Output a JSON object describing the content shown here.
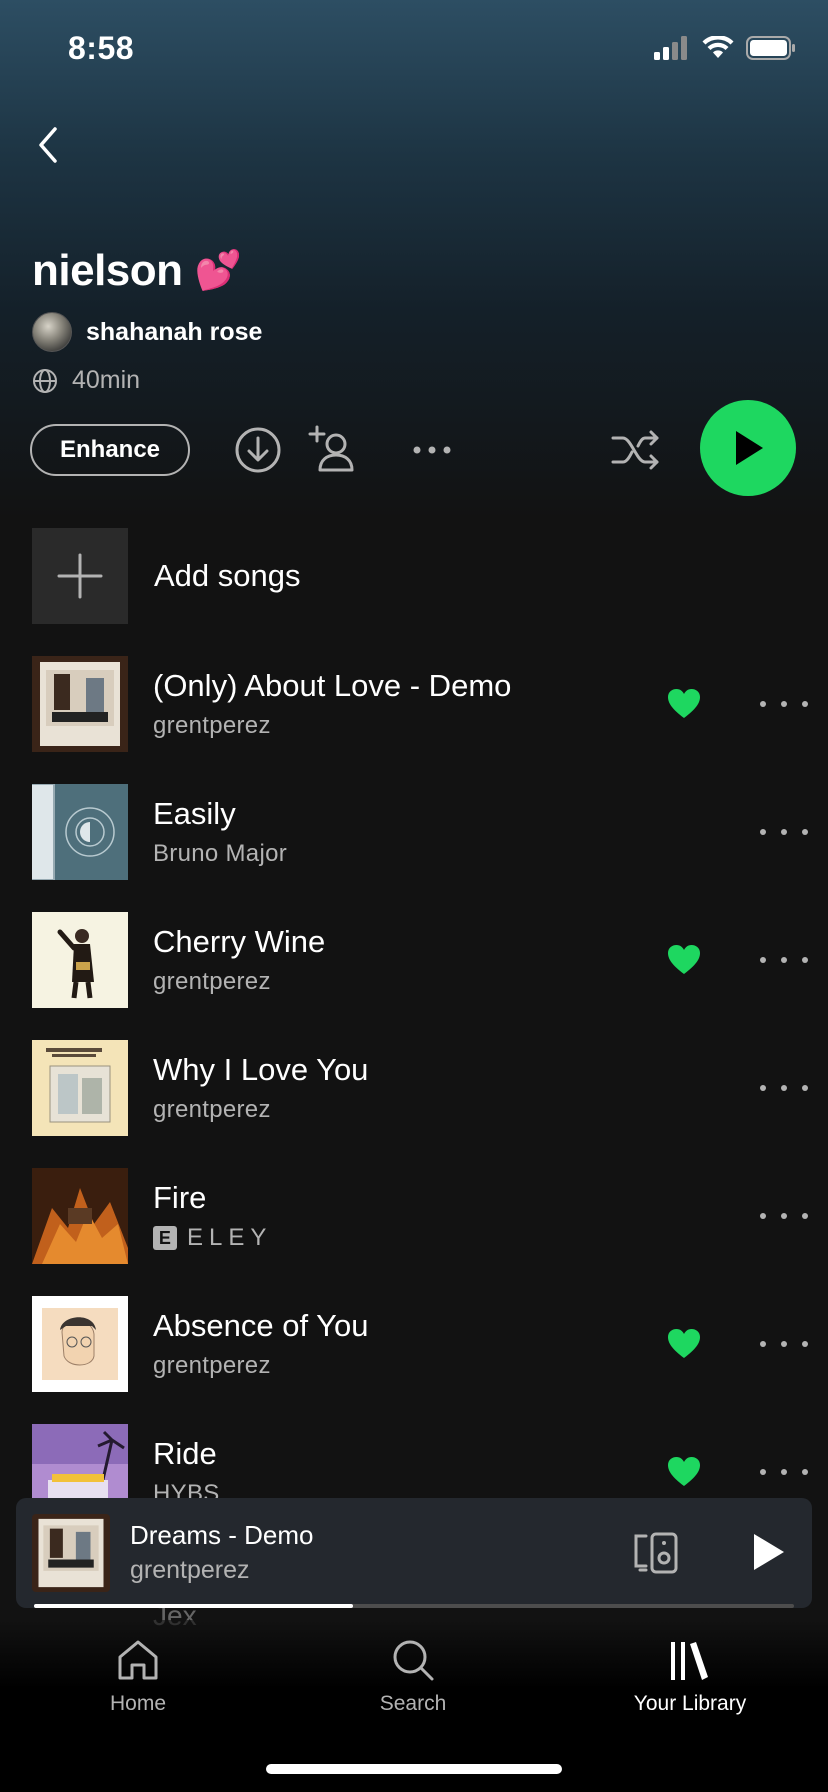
{
  "status": {
    "time": "8:58"
  },
  "playlist": {
    "title": "nielson",
    "title_emoji": "💕",
    "owner": "shahanah rose",
    "duration": "40min",
    "enhance_label": "Enhance"
  },
  "add_songs_label": "Add songs",
  "tracks": [
    {
      "title": "(Only) About Love - Demo",
      "artist": "grentperez",
      "liked": true,
      "explicit": false
    },
    {
      "title": "Easily",
      "artist": "Bruno Major",
      "liked": false,
      "explicit": false
    },
    {
      "title": "Cherry Wine",
      "artist": "grentperez",
      "liked": true,
      "explicit": false
    },
    {
      "title": "Why I Love You",
      "artist": "grentperez",
      "liked": false,
      "explicit": false
    },
    {
      "title": "Fire",
      "artist": "ELEY",
      "liked": false,
      "explicit": true
    },
    {
      "title": "Absence of You",
      "artist": "grentperez",
      "liked": true,
      "explicit": false
    },
    {
      "title": "Ride",
      "artist": "HYBS",
      "liked": true,
      "explicit": false
    },
    {
      "title": "Jex",
      "artist": "",
      "liked": false,
      "explicit": false
    }
  ],
  "explicit_badge": "E",
  "now_playing": {
    "title": "Dreams - Demo",
    "artist": "grentperez",
    "progress": 0.42
  },
  "tabs": [
    {
      "label": "Home",
      "icon": "home-icon",
      "active": false
    },
    {
      "label": "Search",
      "icon": "search-icon",
      "active": false
    },
    {
      "label": "Your Library",
      "icon": "library-icon",
      "active": true
    }
  ],
  "colors": {
    "accent": "#1ed760",
    "background": "#121212",
    "secondary_text": "#b3b3b3"
  }
}
